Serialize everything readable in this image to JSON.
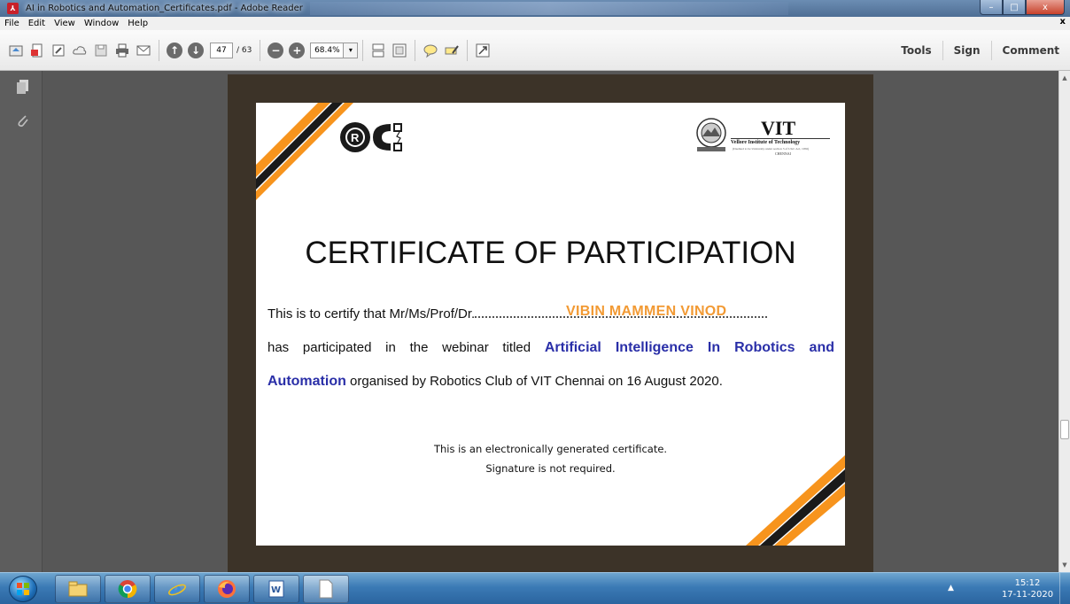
{
  "window": {
    "title": "AI in Robotics and Automation_Certificates.pdf - Adobe Reader",
    "buttons": [
      "–",
      "□",
      "x"
    ]
  },
  "menu": {
    "items": [
      "File",
      "Edit",
      "View",
      "Window",
      "Help"
    ],
    "close": "x"
  },
  "toolbar": {
    "current_page": "47",
    "total_pages": "/ 63",
    "zoom": "68.4%",
    "zoom_dropdown": "▾",
    "right_links": [
      "Tools",
      "Sign",
      "Comment"
    ],
    "icons": [
      "open-icon",
      "create-pdf-icon",
      "edit-icon",
      "cloud-icon",
      "save-icon",
      "print-icon",
      "email-icon",
      "previous-page-icon",
      "next-page-icon",
      "zoom-out-icon",
      "zoom-in-icon",
      "scrolling-mode-icon",
      "fit-page-icon",
      "comment-icon",
      "highlight-icon",
      "full-screen-icon"
    ]
  },
  "certificate": {
    "title": "CERTIFICATE OF PARTICIPATION",
    "line1_prefix": "This is to certify that Mr/Ms/Prof/Dr.",
    "recipient": "VIBIN MAMMEN VINOD",
    "line2_prefix": "has participated in the webinar titled",
    "webinar_part1": "Artificial Intelligence In Robotics and",
    "webinar_part2": "Automation",
    "line3_suffix": "organised by Robotics Club of VIT Chennai on 16 August 2020.",
    "note1": "This is an electronically generated certificate.",
    "note2": "Signature is not required.",
    "logo_right_title": "VIT",
    "logo_right_subtitle": "Vellore Institute of Technology",
    "logo_right_small": "(Deemed to be University under section 3 of UGC Act, 1956)",
    "logo_right_city": "CHENNAI",
    "stripe_orange": "#f7941d",
    "stripe_black": "#1a1a1a"
  },
  "taskbar": {
    "time": "15:12",
    "date": "17-11-2020",
    "tray_arrow": "▲",
    "apps": [
      "file-explorer-icon",
      "chrome-icon",
      "internet-explorer-icon",
      "firefox-icon",
      "word-icon",
      "document-icon"
    ]
  }
}
